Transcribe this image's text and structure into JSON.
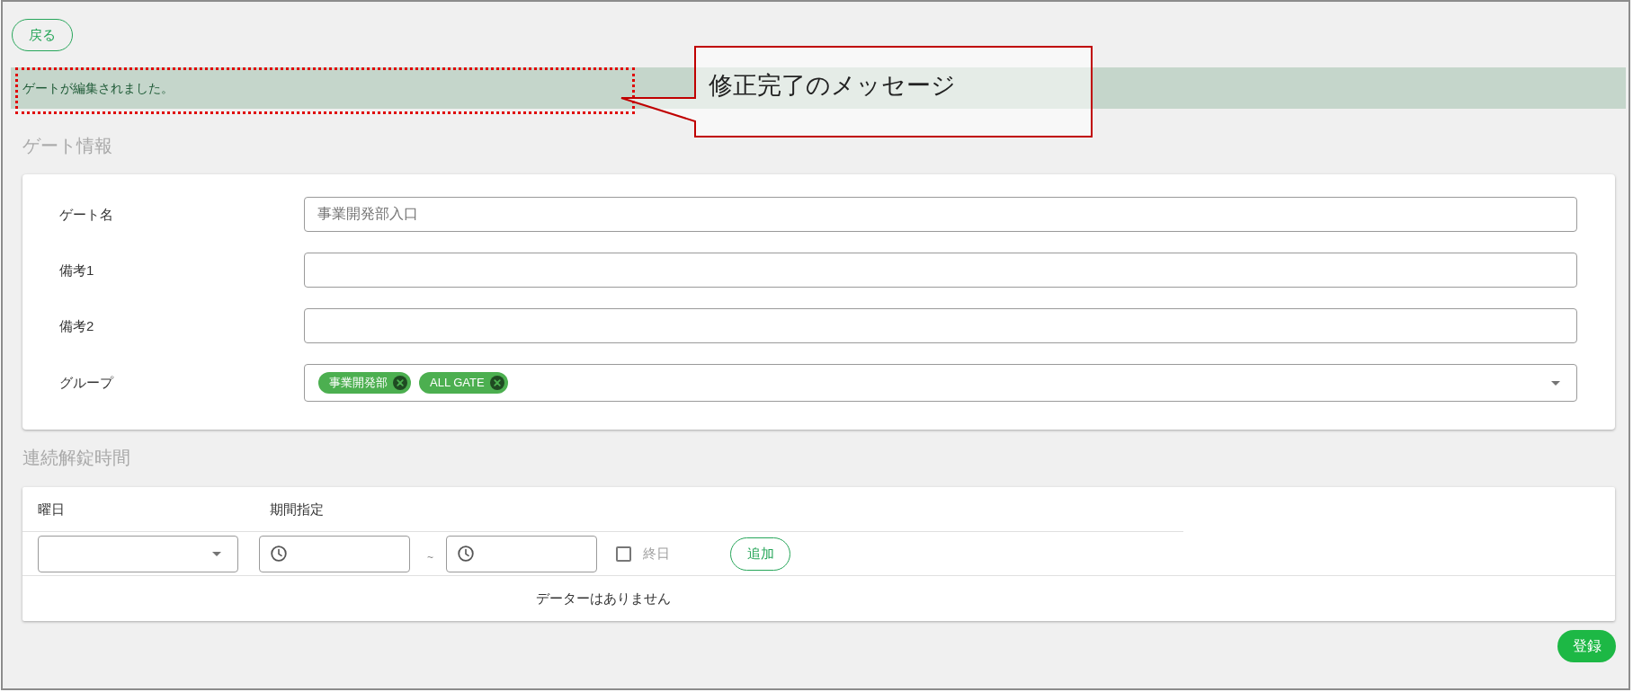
{
  "back_button": "戻る",
  "message": {
    "text": "ゲートが編集されました。"
  },
  "annotation": {
    "text": "修正完了のメッセージ"
  },
  "gate_info": {
    "title": "ゲート情報",
    "fields": [
      {
        "label": "ゲート名",
        "kind": "text",
        "value": "事業開発部入口"
      },
      {
        "label": "備考1",
        "kind": "text"
      },
      {
        "label": "備考2",
        "kind": "text"
      },
      {
        "label": "グループ",
        "kind": "chips",
        "chips": [
          "事業開発部",
          "ALL GATE"
        ]
      }
    ]
  },
  "unlock_schedule": {
    "title": "連続解錠時間",
    "columns": [
      "曜日",
      "期間指定"
    ],
    "separator": "~",
    "all_day": {
      "label": "終日",
      "checked": false
    },
    "add_button": "追加",
    "empty_text": "データーはありません"
  },
  "submit_button": "登録"
}
